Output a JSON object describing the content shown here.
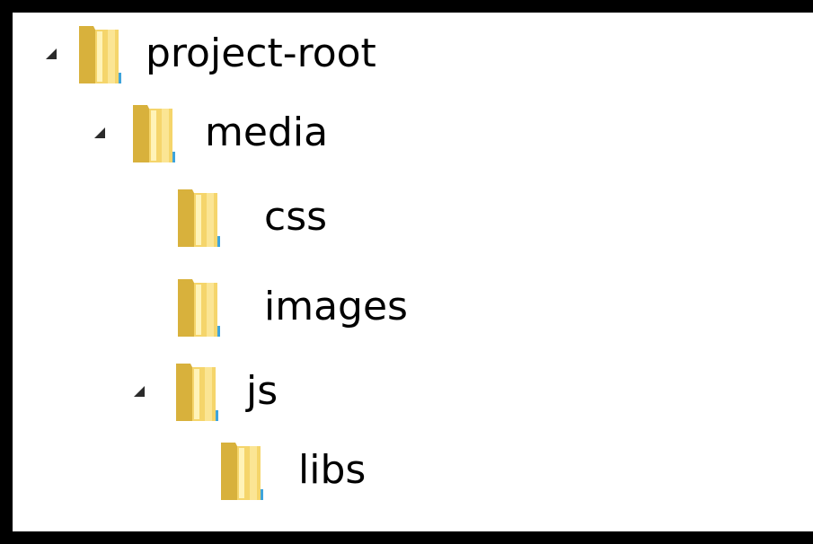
{
  "tree": {
    "items": [
      {
        "label": "project-root",
        "expanded": true,
        "has_children": true,
        "depth": 0,
        "icon": "folder-icon"
      },
      {
        "label": "media",
        "expanded": true,
        "has_children": true,
        "depth": 1,
        "icon": "folder-icon"
      },
      {
        "label": "css",
        "expanded": false,
        "has_children": false,
        "depth": 2,
        "icon": "folder-icon"
      },
      {
        "label": "images",
        "expanded": false,
        "has_children": false,
        "depth": 2,
        "icon": "folder-icon"
      },
      {
        "label": "js",
        "expanded": true,
        "has_children": true,
        "depth": 2,
        "icon": "folder-icon"
      },
      {
        "label": "libs",
        "expanded": false,
        "has_children": false,
        "depth": 3,
        "icon": "folder-icon"
      }
    ]
  },
  "colors": {
    "background": "#ffffff",
    "frame": "#000000",
    "folder_front": "#f5d56b",
    "folder_back": "#d8b13c",
    "folder_highlight": "#fff3b8",
    "folder_accent": "#3ea4dc",
    "expander": "#2b2b2b"
  }
}
